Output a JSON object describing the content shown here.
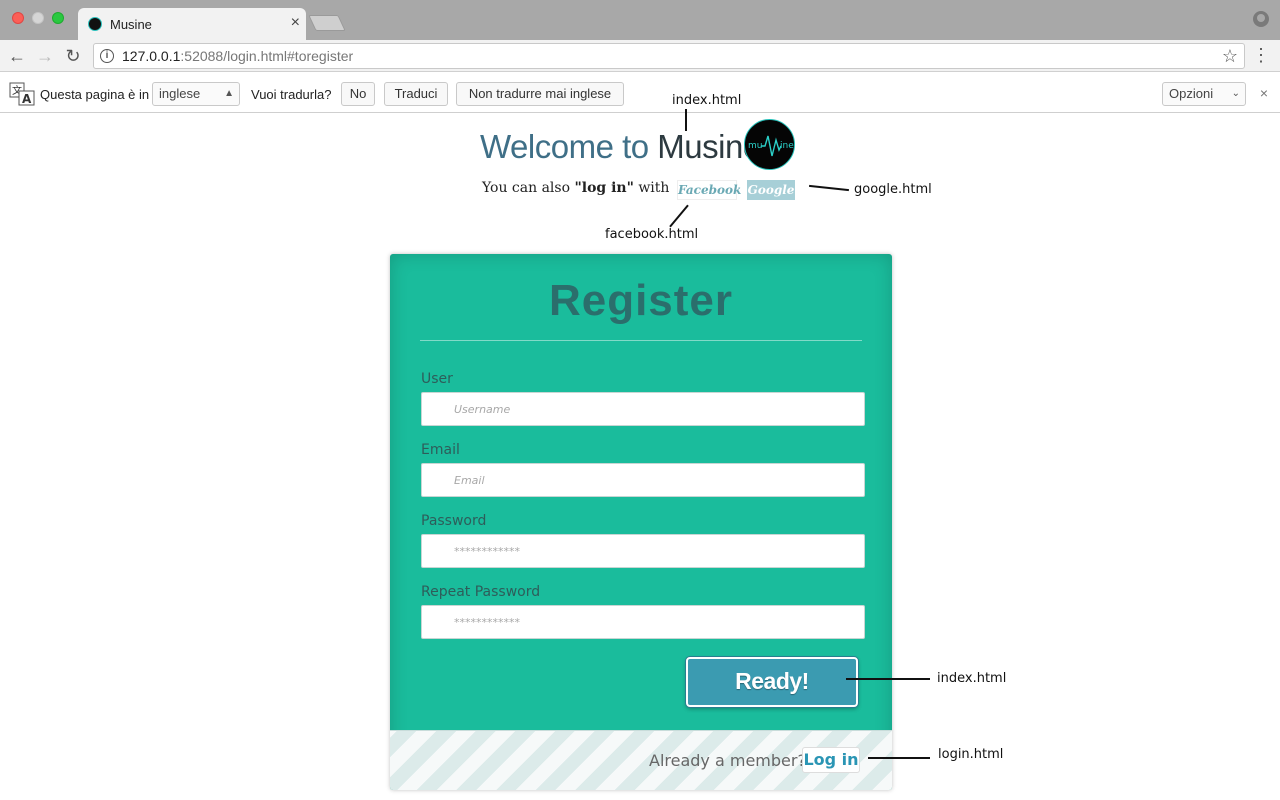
{
  "browser": {
    "tab_title": "Musine",
    "tab_close": "×",
    "url_host": "127.0.0.1",
    "url_rest": ":52088/login.html#toregister"
  },
  "translate_bar": {
    "prefix": "Questa pagina è in",
    "language": "inglese",
    "question": "Vuoi tradurla?",
    "no_label": "No",
    "translate_label": "Traduci",
    "never_label": "Non tradurre mai inglese",
    "options_label": "Opzioni",
    "close": "×"
  },
  "header": {
    "welcome_part1": "Welcome to",
    "welcome_part2": "Musine",
    "also_prefix": "You can also",
    "also_bold": "\"log in\"",
    "also_suffix": "with",
    "facebook_label": "Facebook",
    "google_label": "Google"
  },
  "annotations": {
    "logo_link": "index.html",
    "google_link": "google.html",
    "facebook_link": "facebook.html",
    "ready_link": "index.html",
    "login_link": "login.html"
  },
  "form": {
    "title": "Register",
    "fields": [
      {
        "label": "User",
        "placeholder": "Username"
      },
      {
        "label": "Email",
        "placeholder": "Email"
      },
      {
        "label": "Password",
        "placeholder": "************"
      },
      {
        "label": "Repeat Password",
        "placeholder": "************"
      }
    ],
    "submit_label": "Ready!",
    "footer_text": "Already a member?",
    "login_label": "Log in"
  },
  "colors": {
    "card_bg": "#1abc9c",
    "title_color": "#2b6e6c",
    "button_bg": "#3b9bb1",
    "link_color": "#2a95b4"
  }
}
